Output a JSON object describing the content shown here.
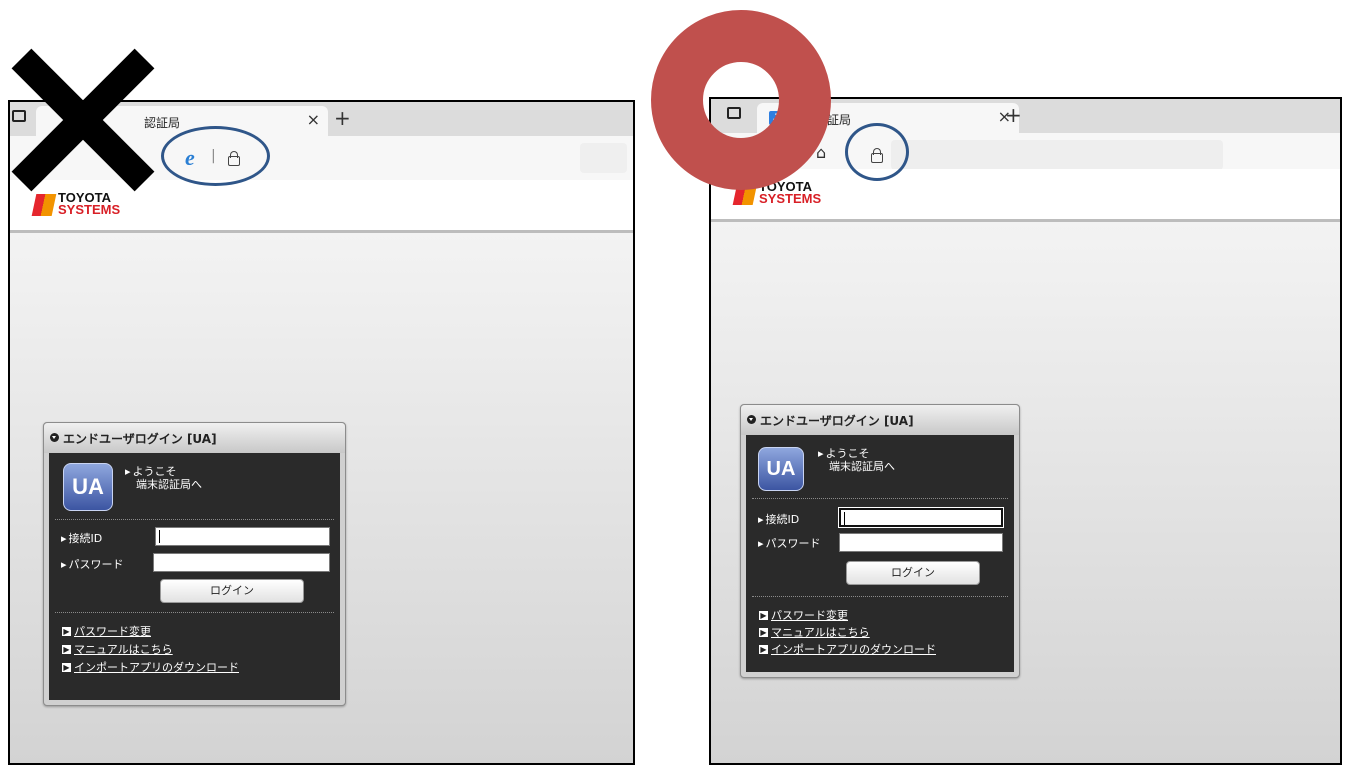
{
  "left": {
    "tab_title": "認証局",
    "tab_close": "×",
    "new_tab": "+",
    "ie_icon": "e",
    "ie_sep": "|",
    "logo": {
      "line1": "TOYOTA",
      "line2": "SYSTEMS"
    },
    "login": {
      "title": "エンドユーザログイン [UA]",
      "ua_label": "UA",
      "welcome_line1": "ようこそ",
      "welcome_line2": "端末認証局へ",
      "id_label": "接続ID",
      "password_label": "パスワード",
      "login_button": "ログイン",
      "links": [
        "パスワード変更",
        "マニュアルはこちら",
        "インポートアプリのダウンロード"
      ]
    }
  },
  "right": {
    "tab_title": "証局",
    "tab_favicon": "J",
    "tab_close": "×",
    "new_tab": "+",
    "home_icon": "⌂",
    "logo": {
      "line1": "TOYOTA",
      "line2": "SYSTEMS"
    },
    "login": {
      "title": "エンドユーザログイン [UA]",
      "ua_label": "UA",
      "welcome_line1": "ようこそ",
      "welcome_line2": "端末認証局へ",
      "id_label": "接続ID",
      "password_label": "パスワード",
      "login_button": "ログイン",
      "links": [
        "パスワード変更",
        "マニュアルはこちら",
        "インポートアプリのダウンロード"
      ]
    }
  },
  "colors": {
    "x_mark": "#000000",
    "o_mark": "#c0504d",
    "highlight_ring": "#2f5689",
    "ie_icon": "#2a7fd4"
  },
  "icons": {
    "x_mark": "cross-mark-icon",
    "o_mark": "circle-mark-icon"
  }
}
